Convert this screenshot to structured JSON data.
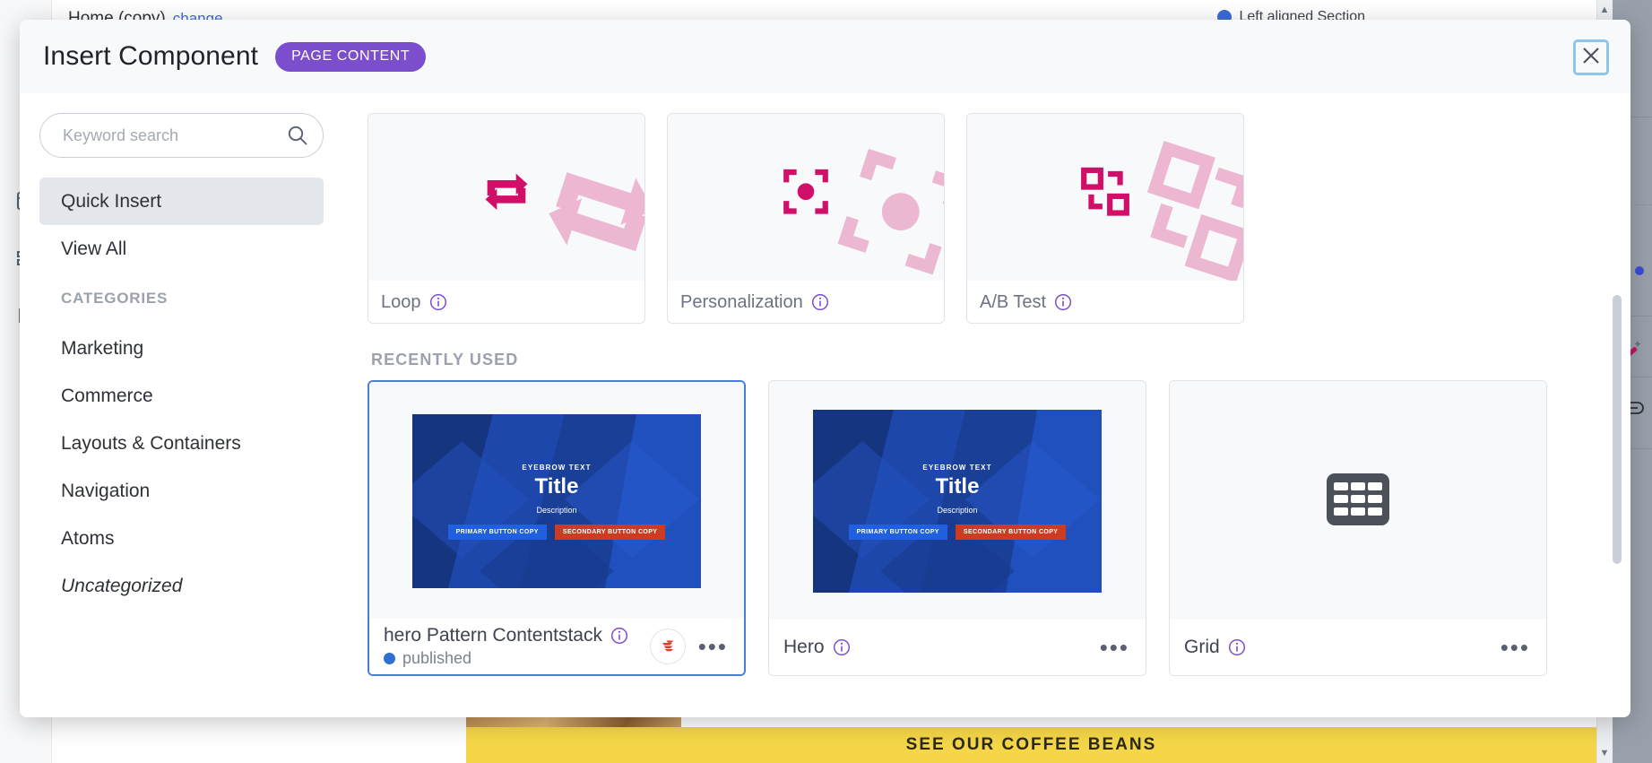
{
  "background": {
    "breadcrumb": "Home (copy)",
    "change_link": "change",
    "top_right_label": "Left aligned Section",
    "banner_text": "SEE OUR COFFEE BEANS"
  },
  "modal": {
    "title": "Insert Component",
    "badge": "PAGE CONTENT",
    "close_icon": "close-icon"
  },
  "search": {
    "placeholder": "Keyword search",
    "value": "",
    "icon": "search-icon"
  },
  "sidebar": {
    "items": [
      {
        "label": "Quick Insert",
        "active": true
      },
      {
        "label": "View All",
        "active": false
      }
    ],
    "categories_heading": "CATEGORIES",
    "categories": [
      {
        "label": "Marketing",
        "italic": false
      },
      {
        "label": "Commerce",
        "italic": false
      },
      {
        "label": "Layouts & Containers",
        "italic": false
      },
      {
        "label": "Navigation",
        "italic": false
      },
      {
        "label": "Atoms",
        "italic": false
      },
      {
        "label": "Uncategorized",
        "italic": true
      }
    ]
  },
  "quick_insert": {
    "cards": [
      {
        "label": "Loop",
        "icon": "loop-icon",
        "info_icon": "info-icon"
      },
      {
        "label": "Personalization",
        "icon": "personalization-icon",
        "info_icon": "info-icon"
      },
      {
        "label": "A/B Test",
        "icon": "ab-test-icon",
        "info_icon": "info-icon"
      }
    ]
  },
  "recently_used": {
    "heading": "RECENTLY USED",
    "cards": [
      {
        "title": "hero Pattern Contentstack",
        "status": "published",
        "status_color": "#2f6fd0",
        "selected": true,
        "has_brand_badge": true,
        "thumbnail": {
          "type": "hero",
          "eyebrow": "EYEBROW TEXT",
          "title": "Title",
          "description": "Description",
          "primary_button": "PRIMARY BUTTON COPY",
          "secondary_button": "SECONDARY BUTTON COPY"
        },
        "menu_icon": "kebab-menu-icon"
      },
      {
        "title": "Hero",
        "status": "",
        "selected": false,
        "has_brand_badge": false,
        "thumbnail": {
          "type": "hero",
          "eyebrow": "EYEBROW TEXT",
          "title": "Title",
          "description": "Description",
          "primary_button": "PRIMARY BUTTON COPY",
          "secondary_button": "SECONDARY BUTTON COPY"
        },
        "menu_icon": "kebab-menu-icon"
      },
      {
        "title": "Grid",
        "status": "",
        "selected": false,
        "has_brand_badge": false,
        "thumbnail": {
          "type": "grid-icon"
        },
        "menu_icon": "kebab-menu-icon"
      }
    ]
  },
  "colors": {
    "accent_purple": "#7c4dcc",
    "icon_magenta": "#cf0f68",
    "selected_blue": "#4a7ddb",
    "status_blue": "#2f6fd0",
    "hero_primary_btn": "#1f5fe0",
    "hero_secondary_btn": "#cf3b20"
  }
}
